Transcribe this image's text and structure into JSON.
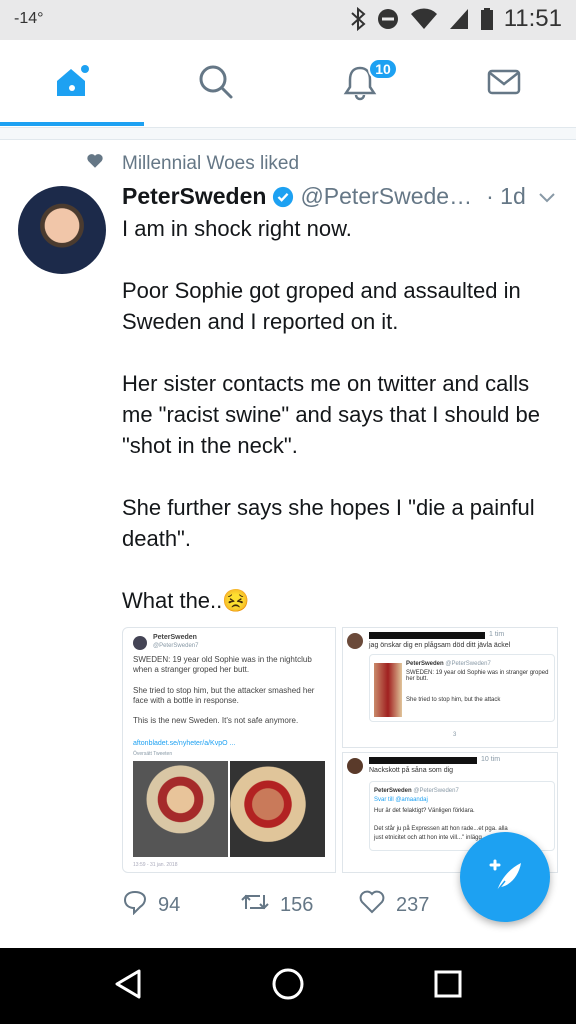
{
  "status_bar": {
    "temperature": "-14°",
    "time": "11:51",
    "icons": [
      "bluetooth-icon",
      "do-not-disturb-icon",
      "wifi-icon",
      "signal-icon",
      "battery-icon"
    ]
  },
  "tabs": [
    {
      "name": "home",
      "icon": "home-icon",
      "active": true
    },
    {
      "name": "search",
      "icon": "search-icon",
      "active": false
    },
    {
      "name": "notifications",
      "icon": "bell-icon",
      "badge": "10",
      "active": false
    },
    {
      "name": "messages",
      "icon": "mail-icon",
      "active": false
    }
  ],
  "tweet": {
    "social_context": "Millennial Woes liked",
    "author_name": "PeterSweden",
    "verified": true,
    "handle": "@PeterSwede…",
    "time": "· 1d",
    "paragraphs": [
      "I am in shock right now.",
      "Poor Sophie got groped and assaulted in Sweden and I reported on it.",
      "Her sister contacts me on twitter and calls me \"racist swine\" and says that I should be \"shot in the neck\".",
      "She further says she hopes I \"die a painful death\"."
    ],
    "last_line": "What the..",
    "emoji": "😣",
    "media": {
      "left": {
        "author": "PeterSweden",
        "handle": "@PeterSweden7",
        "text1": "SWEDEN: 19 year old Sophie was in the nightclub when a stranger groped her butt.",
        "text2": "She tried to stop him, but the attacker smashed her face with a bottle in response.",
        "text3": "This is the new Sweden. It's not safe anymore.",
        "link": "aftonbladet.se/nyheter/a/KvpO ...",
        "translate": "Översätt Tweeten",
        "footer": "13:59 - 31 jan. 2018"
      },
      "top_right": {
        "time": "1 tim",
        "text": "jag önskar dig en plågsam död ditt jävla äckel",
        "quote_author": "PeterSweden",
        "quote_handle": "@PeterSweden7",
        "quote_text": "SWEDEN: 19 year old Sophie was in stranger groped her butt.",
        "quote_text2": "She tried to stop him, but the attack",
        "likes": "3"
      },
      "bottom_right": {
        "time": "10 tim",
        "text": "Nackskott på såna som dig",
        "quote_author": "PeterSweden",
        "quote_handle": "@PeterSweden7",
        "reply_to": "Svar till @amaandaj",
        "line1": "Hur är det felaktigt? Vänligen förklara.",
        "line2": "Det står ju på Expressen att hon rade...et pga. alla",
        "line3": "just etnicitet och att hon inte vill...\" inlägg"
      }
    },
    "actions": {
      "replies": "94",
      "retweets": "156",
      "likes": "237"
    }
  },
  "colors": {
    "accent": "#1da1f2",
    "muted": "#657786",
    "text": "#14171a"
  }
}
